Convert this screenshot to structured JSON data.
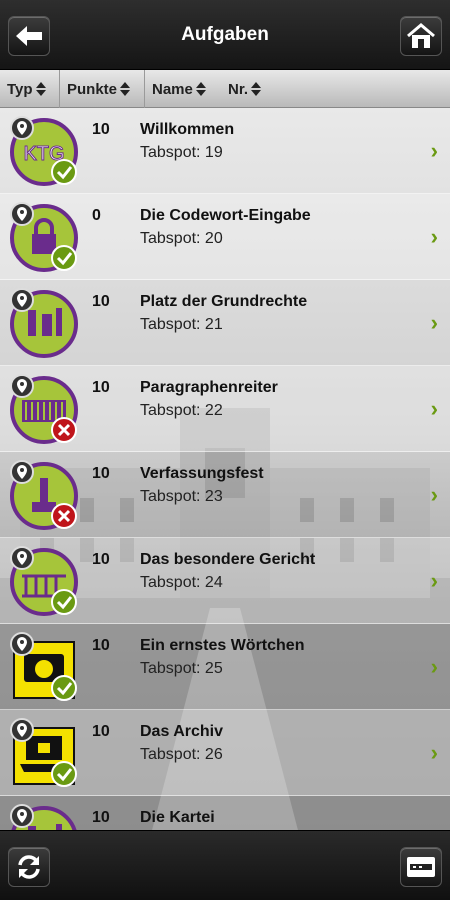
{
  "header": {
    "title": "Aufgaben"
  },
  "sort": {
    "columns": [
      "Typ",
      "Punkte",
      "Name",
      "Nr."
    ]
  },
  "tasks": [
    {
      "points": "10",
      "name": "Willkommen",
      "spot": "Tabspot: 19",
      "status": "done"
    },
    {
      "points": "0",
      "name": "Die Codewort-Eingabe",
      "spot": "Tabspot: 20",
      "status": "done"
    },
    {
      "points": "10",
      "name": "Platz der Grundrechte",
      "spot": "Tabspot: 21",
      "status": "none"
    },
    {
      "points": "10",
      "name": "Paragraphenreiter",
      "spot": "Tabspot: 22",
      "status": "failed"
    },
    {
      "points": "10",
      "name": "Verfassungsfest",
      "spot": "Tabspot: 23",
      "status": "failed"
    },
    {
      "points": "10",
      "name": "Das besondere Gericht",
      "spot": "Tabspot: 24",
      "status": "done"
    },
    {
      "points": "10",
      "name": "Ein ernstes Wörtchen",
      "spot": "Tabspot: 25",
      "status": "done"
    },
    {
      "points": "10",
      "name": "Das Archiv",
      "spot": "Tabspot: 26",
      "status": "done"
    },
    {
      "points": "10",
      "name": "Die Kartei",
      "spot": "",
      "status": "none"
    }
  ],
  "colors": {
    "accent_green": "#a6c53a",
    "accent_purple": "#6a2c8c",
    "accent_yellow": "#f4e100",
    "chevron": "#6a9a12"
  }
}
